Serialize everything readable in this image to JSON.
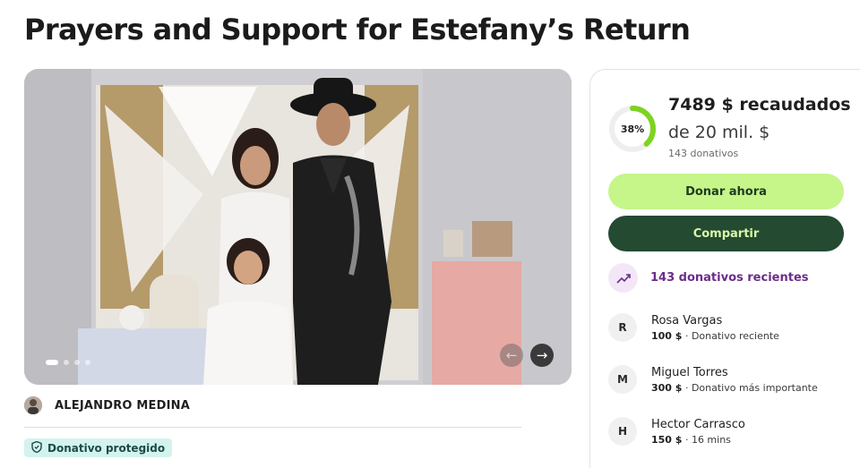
{
  "page": {
    "title": "Prayers and Support for Estefany’s Return"
  },
  "hero": {
    "image_alt": "Family photo: a couple and their young daughter posing in front of decorated backdrop",
    "slide_count": 4,
    "active_slide": 1,
    "prev_icon": "arrow-left-icon",
    "next_icon": "arrow-right-icon",
    "prev_glyph": "←",
    "next_glyph": "→"
  },
  "organizer": {
    "name": "ALEJANDRO MEDINA"
  },
  "badge": {
    "label": "Donativo protegido",
    "icon": "shield-icon"
  },
  "progress": {
    "percent_label": "38%",
    "percent_value": 0.38,
    "raised_label": "7489 $ recaudados",
    "goal_label": "de 20 mil. $",
    "donations_label": "143 donativos"
  },
  "buttons": {
    "donate": "Donar ahora",
    "share": "Compartir"
  },
  "recent": {
    "label": "143 donativos recientes",
    "icon": "trending-up-icon"
  },
  "donors": [
    {
      "initial": "R",
      "name": "Rosa Vargas",
      "amount": "100 $",
      "detail": " · Donativo reciente"
    },
    {
      "initial": "M",
      "name": "Miguel Torres",
      "amount": "300 $",
      "detail": " · Donativo más importante"
    },
    {
      "initial": "H",
      "name": "Hector Carrasco",
      "amount": "150 $",
      "detail": " · 16 mins"
    }
  ],
  "colors": {
    "accent_green": "#c6f58a",
    "dark_green": "#244a31",
    "progress_ring": "#7ed321",
    "purple": "#6b2d8a",
    "badge_bg": "#d3f3ee"
  }
}
